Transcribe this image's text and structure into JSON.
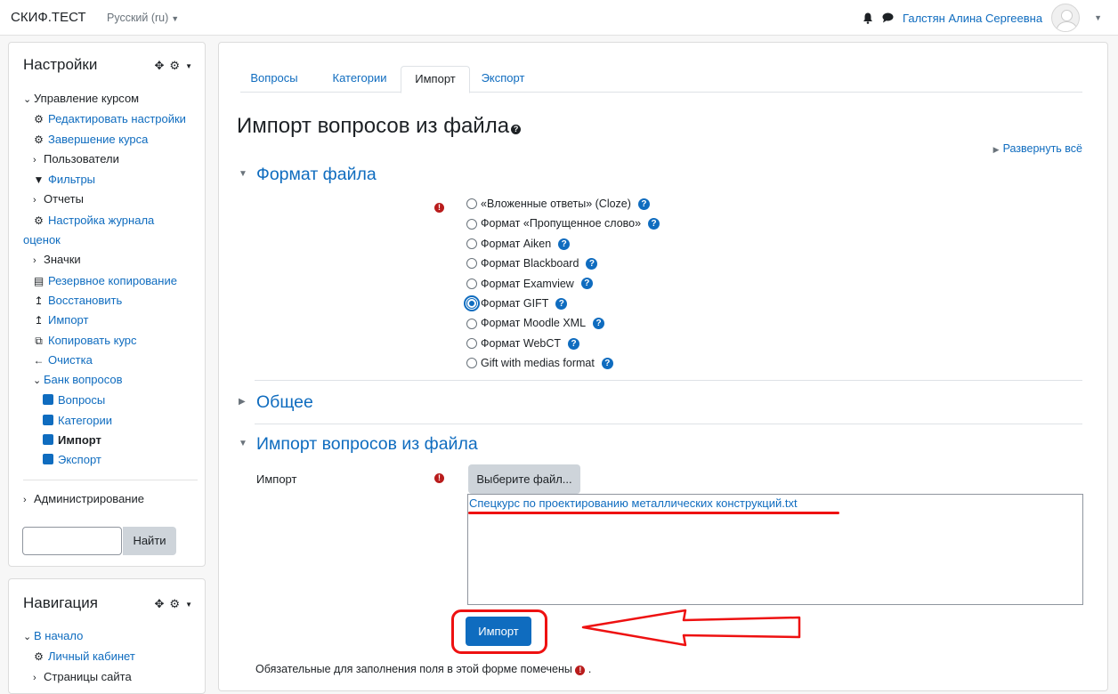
{
  "navbar": {
    "brand": "СКИФ.ТЕСТ",
    "language": "Русский (ru)",
    "user_name": "Галстян Алина Сергеевна"
  },
  "settings_block": {
    "title": "Настройки",
    "items": [
      {
        "label": "Управление курсом",
        "level": 0,
        "chevron": "expanded",
        "icon": null,
        "link": false
      },
      {
        "label": "Редактировать настройки",
        "level": 1,
        "icon": "gear-icon",
        "link": true
      },
      {
        "label": "Завершение курса",
        "level": 1,
        "icon": "gear-icon",
        "link": true
      },
      {
        "label": "Пользователи",
        "level": 1,
        "chevron": "collapsed",
        "link": false
      },
      {
        "label": "Фильтры",
        "level": 1,
        "icon": "filter-icon",
        "link": true
      },
      {
        "label": "Отчеты",
        "level": 1,
        "chevron": "collapsed",
        "link": false
      },
      {
        "label": "Настройка журнала",
        "level": 1,
        "icon": "gear-icon",
        "link": true
      },
      {
        "label": "оценок",
        "level": 1,
        "continuation": true,
        "link": true
      },
      {
        "label": "Значки",
        "level": 1,
        "chevron": "collapsed",
        "link": false
      },
      {
        "label": "Резервное копирование",
        "level": 1,
        "icon": "file-icon",
        "link": true
      },
      {
        "label": "Восстановить",
        "level": 1,
        "icon": "upload-icon",
        "link": true
      },
      {
        "label": "Импорт",
        "level": 1,
        "icon": "upload-icon",
        "link": true
      },
      {
        "label": "Копировать курс",
        "level": 1,
        "icon": "copy-icon",
        "link": true
      },
      {
        "label": "Очистка",
        "level": 1,
        "icon": "arrow-left-icon",
        "link": true
      },
      {
        "label": "Банк вопросов",
        "level": 1,
        "chevron": "expanded",
        "link": true
      },
      {
        "label": "Вопросы",
        "level": 2,
        "icon": "square-icon",
        "link": true
      },
      {
        "label": "Категории",
        "level": 2,
        "icon": "square-icon",
        "link": true
      },
      {
        "label": "Импорт",
        "level": 2,
        "icon": "square-icon",
        "link": false,
        "active": true
      },
      {
        "label": "Экспорт",
        "level": 2,
        "icon": "square-icon",
        "link": true
      }
    ],
    "admin_label": "Администрирование",
    "search_button": "Найти"
  },
  "nav_block": {
    "title": "Навигация",
    "items": [
      {
        "label": "В начало",
        "level": 0,
        "chevron": "expanded",
        "link": true
      },
      {
        "label": "Личный кабинет",
        "level": 1,
        "icon": "dashboard-icon",
        "link": true
      },
      {
        "label": "Страницы сайта",
        "level": 1,
        "chevron": "collapsed",
        "link": false
      }
    ]
  },
  "main": {
    "tabs": [
      {
        "label": "Вопросы",
        "active": false
      },
      {
        "label": "Категории",
        "active": false
      },
      {
        "label": "Импорт",
        "active": true
      },
      {
        "label": "Экспорт",
        "active": false
      }
    ],
    "page_title": "Импорт вопросов из файла",
    "expand_all": "Развернуть всё",
    "section_format": "Формат файла",
    "formats": [
      {
        "label": "«Вложенные ответы» (Cloze)",
        "checked": false
      },
      {
        "label": "Формат «Пропущенное слово»",
        "checked": false
      },
      {
        "label": "Формат Aiken",
        "checked": false
      },
      {
        "label": "Формат Blackboard",
        "checked": false
      },
      {
        "label": "Формат Examview",
        "checked": false
      },
      {
        "label": "Формат GIFT",
        "checked": true
      },
      {
        "label": "Формат Moodle XML",
        "checked": false
      },
      {
        "label": "Формат WebCT",
        "checked": false
      },
      {
        "label": "Gift with medias format",
        "checked": false
      }
    ],
    "section_general": "Общее",
    "section_import": "Импорт вопросов из файла",
    "import_label": "Импорт",
    "choose_file_button": "Выберите файл...",
    "file_name": "Спецкурс по проектированию металлических конструкций.txt",
    "import_button": "Импорт",
    "required_note": "Обязательные для заполнения поля в этой форме помечены",
    "required_note_end": "."
  },
  "colors": {
    "link": "#0f6cbf",
    "required": "#b91c1c",
    "annotation": "#ee1111"
  }
}
